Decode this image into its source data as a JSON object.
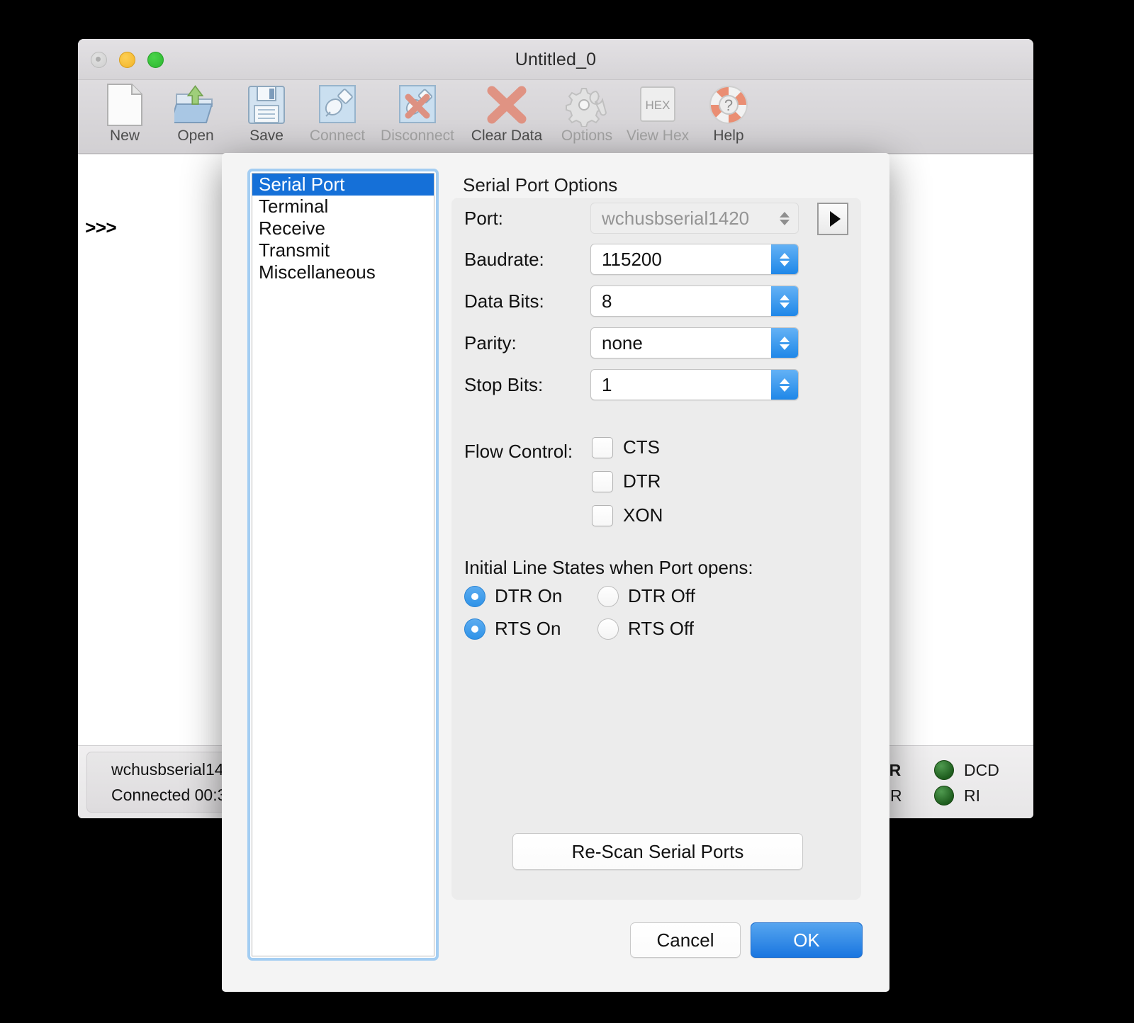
{
  "window": {
    "title": "Untitled_0",
    "traffic_lights": [
      "close-button",
      "minimize-button",
      "maximize-button"
    ]
  },
  "toolbar": {
    "items": [
      {
        "label": "New",
        "icon": "new-document-icon",
        "disabled": false
      },
      {
        "label": "Open",
        "icon": "open-folder-icon",
        "disabled": false
      },
      {
        "label": "Save",
        "icon": "floppy-disk-icon",
        "disabled": false
      },
      {
        "label": "Connect",
        "icon": "plug-connect-icon",
        "disabled": true
      },
      {
        "label": "Disconnect",
        "icon": "plug-disconnect-icon",
        "disabled": true
      },
      {
        "label": "Clear Data",
        "icon": "red-x-icon",
        "disabled": false
      },
      {
        "label": "Options",
        "icon": "gear-wrench-icon",
        "disabled": true
      },
      {
        "label": "View Hex",
        "icon": "hex-badge-icon",
        "disabled": true
      },
      {
        "label": "Help",
        "icon": "lifebuoy-help-icon",
        "disabled": false
      }
    ]
  },
  "terminal": {
    "prompt": ">>>"
  },
  "statusbar": {
    "port_line": "wchusbserial14",
    "connected_line": "Connected 00:3",
    "signals": [
      {
        "name": "DTR",
        "bold": true,
        "led": "green",
        "paired": "DCD"
      },
      {
        "name": "DSR",
        "bold": false,
        "led": "green",
        "paired": "RI"
      }
    ],
    "led_color": "#2f7a2f"
  },
  "dialog": {
    "categories": [
      {
        "label": "Serial Port",
        "selected": true
      },
      {
        "label": "Terminal",
        "selected": false
      },
      {
        "label": "Receive",
        "selected": false
      },
      {
        "label": "Transmit",
        "selected": false
      },
      {
        "label": "Miscellaneous",
        "selected": false
      }
    ],
    "pane_title": "Serial Port Options",
    "fields": [
      {
        "label": "Port:",
        "value": "wchusbserial1420",
        "disabled": true
      },
      {
        "label": "Baudrate:",
        "value": "115200",
        "disabled": false
      },
      {
        "label": "Data Bits:",
        "value": "8",
        "disabled": false
      },
      {
        "label": "Parity:",
        "value": "none",
        "disabled": false
      },
      {
        "label": "Stop Bits:",
        "value": "1",
        "disabled": false
      }
    ],
    "port_side_button": "expand-port-list-button",
    "flow_control": {
      "label": "Flow Control:",
      "options": [
        {
          "label": "CTS",
          "checked": false
        },
        {
          "label": "DTR",
          "checked": false
        },
        {
          "label": "XON",
          "checked": false
        }
      ]
    },
    "line_states": {
      "label": "Initial Line States when Port opens:",
      "options": [
        {
          "label": "DTR On",
          "selected": true
        },
        {
          "label": "DTR Off",
          "selected": false
        },
        {
          "label": "RTS On",
          "selected": true
        },
        {
          "label": "RTS Off",
          "selected": false
        }
      ]
    },
    "rescan_label": "Re-Scan Serial Ports",
    "cancel_label": "Cancel",
    "ok_label": "OK",
    "accent_color": "#1570d8",
    "focus_ring_color": "#a3cdf2"
  }
}
